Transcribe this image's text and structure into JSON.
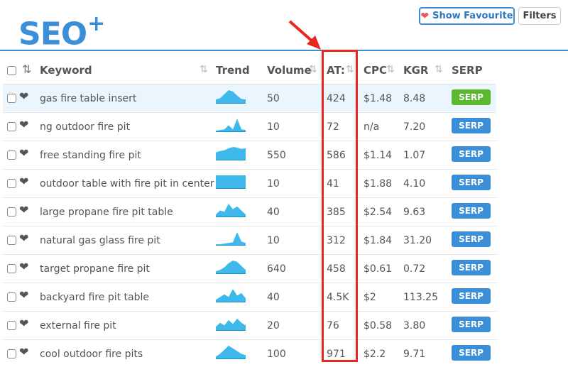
{
  "brand": {
    "logo": "SEO",
    "logo_sup": "+"
  },
  "toolbar": {
    "favourite_label": "Show Favourite",
    "filters_label": "Filters"
  },
  "columns": {
    "keyword": "Keyword",
    "trend": "Trend",
    "volume": "Volume",
    "at": "AT:",
    "cpc": "CPC",
    "kgr": "KGR",
    "serp": "SERP"
  },
  "icons": {
    "sort": "sort-arrows-icon",
    "heart": "heart-icon",
    "arrow": "red-arrow-annotation"
  },
  "colors": {
    "accent": "#3b8fd9",
    "serp_green": "#5cb82f",
    "highlight": "#e8281e",
    "trend_fill": "#3fb8ec"
  },
  "rows": [
    {
      "keyword": "gas fire table insert",
      "volume": "50",
      "at": "424",
      "cpc": "$1.48",
      "kgr": "8.48",
      "serp": "SERP",
      "trend": [
        0.3,
        0.4,
        0.7,
        1,
        0.9,
        0.6,
        0.35,
        0.3
      ]
    },
    {
      "keyword": "ng outdoor fire pit",
      "volume": "10",
      "at": "72",
      "cpc": "n/a",
      "kgr": "7.20",
      "serp": "SERP",
      "trend": [
        0.1,
        0.15,
        0.2,
        0.5,
        0.2,
        1,
        0.2,
        0.15
      ]
    },
    {
      "keyword": "free standing fire pit",
      "volume": "550",
      "at": "586",
      "cpc": "$1.14",
      "kgr": "1.07",
      "serp": "SERP",
      "trend": [
        0.6,
        0.7,
        0.75,
        0.9,
        1,
        0.95,
        0.85,
        0.9
      ]
    },
    {
      "keyword": "outdoor table with fire pit in center",
      "volume": "10",
      "at": "41",
      "cpc": "$1.88",
      "kgr": "4.10",
      "serp": "SERP",
      "trend": [
        1,
        1,
        1,
        1,
        1,
        1,
        1,
        1
      ]
    },
    {
      "keyword": "large propane fire pit table",
      "volume": "40",
      "at": "385",
      "cpc": "$2.54",
      "kgr": "9.63",
      "serp": "SERP",
      "trend": [
        0.2,
        0.5,
        0.4,
        1,
        0.6,
        0.8,
        0.5,
        0.2
      ]
    },
    {
      "keyword": "natural gas glass fire pit",
      "volume": "10",
      "at": "312",
      "cpc": "$1.84",
      "kgr": "31.20",
      "serp": "SERP",
      "trend": [
        0.1,
        0.1,
        0.15,
        0.2,
        0.25,
        1,
        0.3,
        0.2
      ]
    },
    {
      "keyword": "target propane fire pit",
      "volume": "640",
      "at": "458",
      "cpc": "$0.61",
      "kgr": "0.72",
      "serp": "SERP",
      "trend": [
        0.2,
        0.3,
        0.5,
        0.8,
        1,
        0.9,
        0.6,
        0.3
      ]
    },
    {
      "keyword": "backyard fire pit table",
      "volume": "40",
      "at": "4.5K",
      "cpc": "$2",
      "kgr": "113.25",
      "serp": "SERP",
      "trend": [
        0.2,
        0.4,
        0.6,
        0.4,
        1,
        0.5,
        0.7,
        0.3
      ]
    },
    {
      "keyword": "external fire pit",
      "volume": "20",
      "at": "76",
      "cpc": "$0.58",
      "kgr": "3.80",
      "serp": "SERP",
      "trend": [
        0.3,
        0.6,
        0.4,
        0.8,
        0.5,
        0.9,
        0.6,
        0.4
      ]
    },
    {
      "keyword": "cool outdoor fire pits",
      "volume": "100",
      "at": "971",
      "cpc": "$2.2",
      "kgr": "9.71",
      "serp": "SERP",
      "trend": [
        0.2,
        0.4,
        0.7,
        1,
        0.8,
        0.6,
        0.4,
        0.3
      ]
    }
  ]
}
